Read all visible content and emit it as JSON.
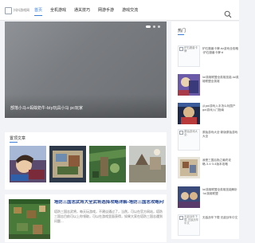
{
  "site": {
    "logo_text": "抖抖游戏网"
  },
  "nav": {
    "items": [
      {
        "label": "首页"
      },
      {
        "label": "全机游戏"
      },
      {
        "label": "通关技巧"
      },
      {
        "label": "网游手游"
      },
      {
        "label": "游戏交流"
      }
    ],
    "active_index": 0
  },
  "hero": {
    "caption": "部落小马+蚂蚁奶牛-biy玩具小马 pc玩家",
    "slide_count": 3,
    "active_slide": 0
  },
  "recommended": {
    "title": "置顶文章",
    "thumbnails": [
      "thumb-1",
      "thumb-2",
      "thumb-3",
      "thumb-4"
    ]
  },
  "article": {
    "title": "塔防三国志武将大全武将选择攻略详解-塔防三国志攻略问答",
    "summary": "塔防三国志武将，每天玩游戏，不建议通过了，当然，可以在官方网站，塔防三国志目前可以上你领取，可以在游戏里面获得，如果大家在塔防三国志遇到问题..."
  },
  "sidebar": {
    "heading": "热门",
    "items": [
      {
        "image_alt": "炉石魔兽卡牌",
        "text": "炉石魔兽卡牌-dz游戏全攻略·炉石魔兽卡牌·d",
        "blank": true
      },
      {
        "image_alt": "",
        "text": "lol英雄联盟全英雄技能-lol英雄联盟全英雄",
        "blank": false
      },
      {
        "image_alt": "",
        "text": "从gal游戏入手怎么玩国产gal游戏入门指南",
        "blank": false
      },
      {
        "image_alt": "原始游戏大全-",
        "text": "原始游戏大全·新版原始游戏大全",
        "blank": true
      },
      {
        "image_alt": "",
        "text": "我是三国后勤之最终攻略-3.4·3.4版本攻略",
        "blank": false
      },
      {
        "image_alt": "",
        "text": "lol英雄联盟全英雄技能解析·lol英雄联盟",
        "blank": false
      },
      {
        "image_alt": "无敌战车下载-无敌战车中文",
        "text": "无敌战车下载·无敌战车中文",
        "blank": true
      }
    ]
  },
  "colors": {
    "accent": "#3b7dd8",
    "title_blue": "#1f3f8c",
    "page_bg": "#f1f3f6"
  }
}
